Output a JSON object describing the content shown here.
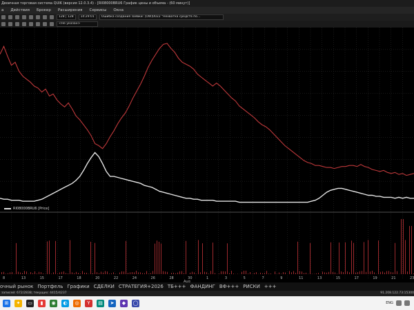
{
  "window": {
    "title": "Двоичная торговая система QUIK (версия 12.0.3.4) - [RI08000BRU6 График цены и объема - (60 минут)]"
  },
  "menubar": {
    "items": [
      "а",
      "Действия",
      "Брокер",
      "Расширения",
      "Сервисы",
      "Окна"
    ]
  },
  "toolbar2": {
    "field1": "128 | 128",
    "field2": "14:29:01",
    "field3": "Ошибка создания заявки: [OW]0022 \"Нехватка средств по...",
    "dropdown": "<Не указан>"
  },
  "chart": {
    "legend_label": "RI08000BRU6 [Price]",
    "x_ticks": [
      "8",
      "13",
      "15",
      "17",
      "18",
      "20",
      "22",
      "24",
      "26",
      "28",
      "30",
      "1",
      "3",
      "5",
      "7",
      "9",
      "11",
      "13",
      "15",
      "17",
      "19",
      "21",
      "23"
    ],
    "x_month_label": "Aug",
    "colors": {
      "background": "#000000",
      "red_line": "#c0393b",
      "white_line": "#e6e6e6",
      "grid": "#3a3a3a",
      "volume": "#a02a2e"
    }
  },
  "chart_data": {
    "type": "line",
    "series": [
      {
        "values": [
          150,
          158,
          148,
          139,
          142,
          133,
          128,
          125,
          122,
          118,
          116,
          112,
          115,
          108,
          110,
          104,
          100,
          97,
          101,
          95,
          88,
          84,
          79,
          74,
          68,
          60,
          58,
          55,
          60,
          67,
          73,
          80,
          86,
          91,
          98,
          106,
          113,
          120,
          128,
          137,
          144,
          150,
          156,
          160,
          161,
          156,
          152,
          146,
          142,
          140,
          138,
          135,
          130,
          127,
          124,
          121,
          118,
          121,
          118,
          114,
          110,
          106,
          103,
          98,
          95,
          92,
          89,
          86,
          82,
          79,
          77,
          74,
          70,
          66,
          62,
          58,
          55,
          52,
          49,
          46,
          43,
          41,
          40,
          38,
          38,
          37,
          36,
          36,
          35,
          36,
          37,
          37,
          38,
          38,
          37,
          39,
          37,
          36,
          34,
          33,
          32,
          33,
          31,
          30,
          31,
          29,
          30,
          28,
          29,
          30
        ]
      },
      {
        "values": [
          5,
          4,
          4,
          3,
          3,
          3,
          2,
          2,
          2,
          2,
          3,
          4,
          6,
          8,
          10,
          12,
          14,
          16,
          18,
          20,
          23,
          27,
          33,
          40,
          46,
          51,
          47,
          40,
          32,
          27,
          27,
          26,
          25,
          24,
          23,
          22,
          21,
          20,
          18,
          17,
          16,
          14,
          12,
          11,
          10,
          9,
          8,
          7,
          6,
          5,
          5,
          4,
          4,
          3,
          3,
          3,
          3,
          2,
          2,
          2,
          2,
          2,
          2,
          1,
          1,
          1,
          1,
          1,
          1,
          1,
          1,
          1,
          1,
          1,
          1,
          1,
          1,
          1,
          1,
          1,
          1,
          1,
          2,
          3,
          5,
          8,
          11,
          13,
          14,
          15,
          15,
          14,
          13,
          12,
          11,
          10,
          9,
          8,
          8,
          7,
          7,
          6,
          6,
          6,
          5,
          6,
          5,
          6,
          5,
          5
        ]
      }
    ]
  },
  "bottom_tabs": [
    "очный рынок",
    "Портфель",
    "Графики",
    "СДЕЛКИ",
    "СТРАТЕГИЯ+2026",
    "ТБ+++",
    "ФАНДИНГ",
    "ВФ+++",
    "РИСКИ",
    "+++"
  ],
  "statusbar": {
    "left": "записей: 672/2838; текущих: 4415/4237",
    "right": "91.208.122.73:15300"
  },
  "taskbar": {
    "lang": "ENG"
  }
}
